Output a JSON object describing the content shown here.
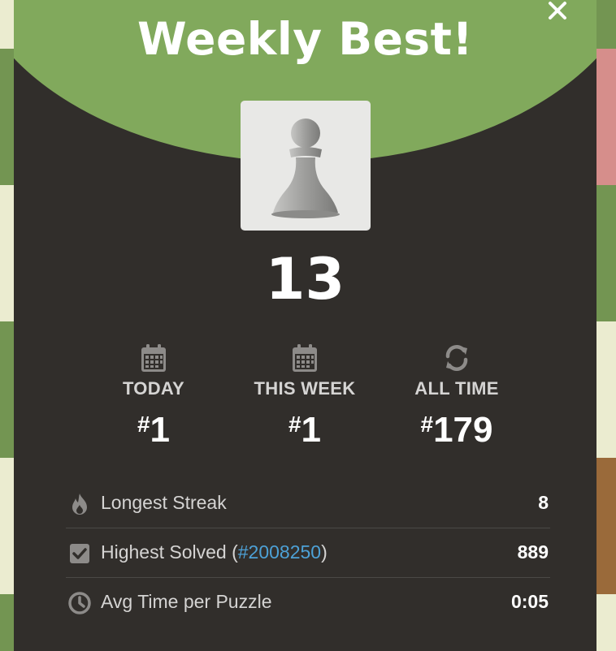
{
  "modal": {
    "title": "Weekly Best!",
    "score": "13",
    "close_icon": "close-icon",
    "piece_icon": "pawn-icon"
  },
  "ranks": [
    {
      "icon": "calendar-icon",
      "label": "TODAY",
      "hash": "#",
      "value": "1"
    },
    {
      "icon": "calendar-icon",
      "label": "THIS WEEK",
      "hash": "#",
      "value": "1"
    },
    {
      "icon": "refresh-icon",
      "label": "ALL TIME",
      "hash": "#",
      "value": "179"
    }
  ],
  "stats": [
    {
      "icon": "flame-icon",
      "label": "Longest Streak",
      "value": "8"
    },
    {
      "icon": "checkbox-icon",
      "label_prefix": "Highest Solved (",
      "link": "#2008250",
      "label_suffix": ")",
      "value": "889"
    },
    {
      "icon": "clock-icon",
      "label": "Avg Time per Puzzle",
      "value": "0:05"
    }
  ],
  "colors": {
    "header_green": "#81a95c",
    "modal_bg": "#312e2b",
    "link_blue": "#4da1d6",
    "board_light": "#ebecd0",
    "board_dark": "#739552"
  }
}
